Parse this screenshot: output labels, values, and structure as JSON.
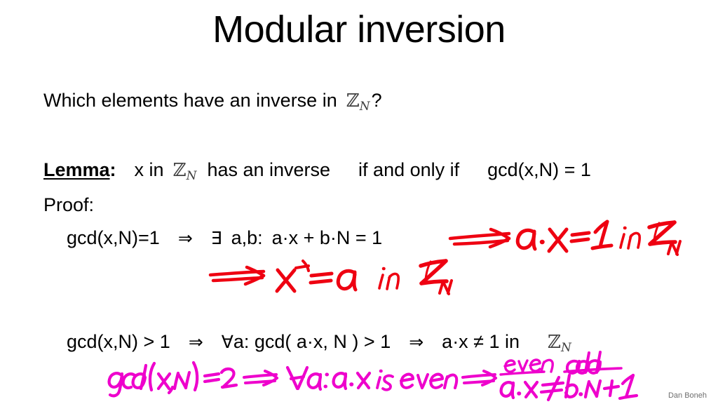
{
  "slide": {
    "title": "Modular inversion",
    "footer": "Dan Boneh",
    "background_color": "#ffffff",
    "text_color": "#000000",
    "ink_red": "#ee0011",
    "ink_magenta": "#ee00cc",
    "math_gray": "#3f3f3f"
  },
  "question": {
    "prefix": "Which elements have an inverse in",
    "set": "Z",
    "set_subscript": "N",
    "suffix": "?"
  },
  "lemma": {
    "label": "Lemma",
    "colon": ":",
    "part1": "x in",
    "set": "Z",
    "set_subscript": "N",
    "part2": "has an inverse",
    "part3": "if and only if",
    "part4": "gcd(x,N) = 1"
  },
  "proof": {
    "label": "Proof:"
  },
  "equation_forward": {
    "lhs": "gcd(x,N)=1",
    "implies": "⇒",
    "exists": "∃",
    "quantified": "a,b:",
    "rhs": "a·x + b·N = 1"
  },
  "equation_backward": {
    "lhs": "gcd(x,N) > 1",
    "implies1": "⇒",
    "forall": "∀",
    "mid": "a:  gcd( a·x, N ) > 1",
    "implies2": "⇒",
    "rhs": "a·x ≠ 1  in",
    "set": "Z",
    "set_subscript": "N"
  },
  "annotations": {
    "red_line1": {
      "color": "#ee0011",
      "arrow": "⟹",
      "text": "a·x = 1  in  Z_N",
      "parts": [
        "a·x",
        "=",
        "1",
        "in",
        "Z",
        "N"
      ]
    },
    "red_line2": {
      "color": "#ee0011",
      "arrow": "⟹",
      "text": "x⁻¹ = a  in  Z_N",
      "parts": [
        "x",
        "-1",
        "=",
        "a",
        "in",
        "Z",
        "N"
      ]
    },
    "magenta_line": {
      "color": "#ee00cc",
      "text": "gcd(x,N) = 2  ⟹  ∀a: a·x is even ⟹ a·x ≠ b·N+1",
      "parts": [
        "gcd(x,N) =2",
        "⟹",
        "∀a:",
        "a·x",
        "is",
        "even",
        "⟹",
        "a·x",
        "≠",
        "b·N+1"
      ],
      "label_over_left": "even",
      "label_over_right": "odd"
    }
  }
}
